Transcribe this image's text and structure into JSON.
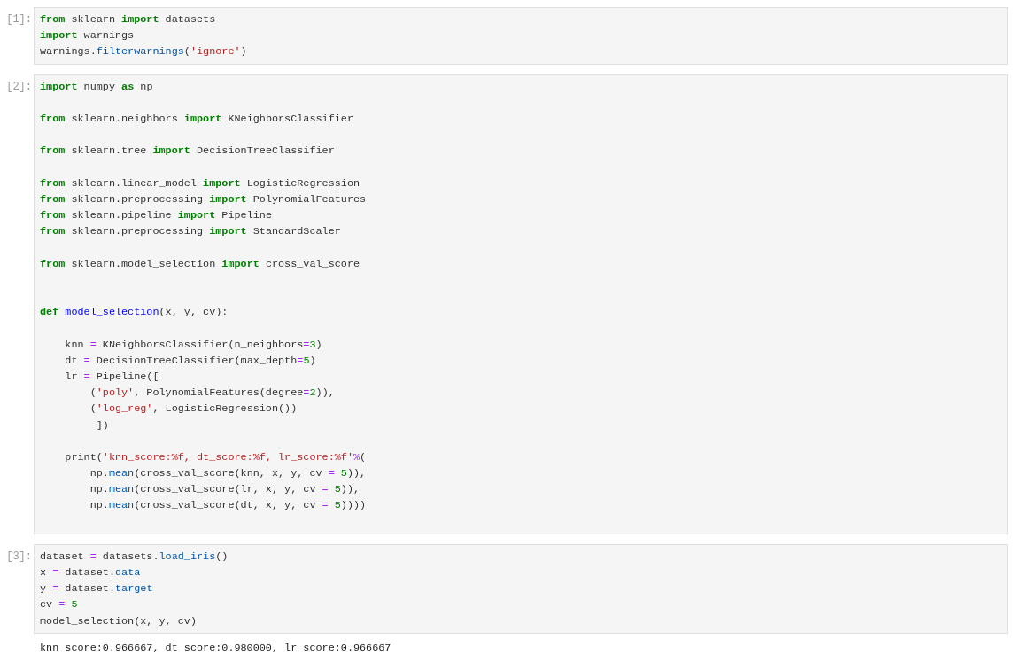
{
  "cells": [
    {
      "prompt": "[1]:",
      "lines": [
        {
          "kind": "code",
          "tokens": [
            {
              "kind": "kw",
              "text": "from"
            },
            {
              "kind": "plain",
              "text": " sklearn "
            },
            {
              "kind": "kw",
              "text": "import"
            },
            {
              "kind": "plain",
              "text": " datasets"
            }
          ]
        },
        {
          "kind": "code",
          "tokens": [
            {
              "kind": "kw",
              "text": "import"
            },
            {
              "kind": "plain",
              "text": " warnings"
            }
          ]
        },
        {
          "kind": "code",
          "tokens": [
            {
              "kind": "plain",
              "text": "warnings."
            },
            {
              "kind": "prop",
              "text": "filterwarnings"
            },
            {
              "kind": "plain",
              "text": "("
            },
            {
              "kind": "str",
              "text": "'ignore'"
            },
            {
              "kind": "plain",
              "text": ")"
            }
          ]
        }
      ]
    },
    {
      "prompt": "[2]:",
      "lines": [
        {
          "kind": "code",
          "tokens": [
            {
              "kind": "kw",
              "text": "import"
            },
            {
              "kind": "plain",
              "text": " numpy "
            },
            {
              "kind": "kw",
              "text": "as"
            },
            {
              "kind": "plain",
              "text": " np"
            }
          ]
        },
        {
          "kind": "blank"
        },
        {
          "kind": "code",
          "tokens": [
            {
              "kind": "kw",
              "text": "from"
            },
            {
              "kind": "plain",
              "text": " sklearn.neighbors "
            },
            {
              "kind": "kw",
              "text": "import"
            },
            {
              "kind": "plain",
              "text": " KNeighborsClassifier"
            }
          ]
        },
        {
          "kind": "blank"
        },
        {
          "kind": "code",
          "tokens": [
            {
              "kind": "kw",
              "text": "from"
            },
            {
              "kind": "plain",
              "text": " sklearn.tree "
            },
            {
              "kind": "kw",
              "text": "import"
            },
            {
              "kind": "plain",
              "text": " DecisionTreeClassifier"
            }
          ]
        },
        {
          "kind": "blank"
        },
        {
          "kind": "code",
          "tokens": [
            {
              "kind": "kw",
              "text": "from"
            },
            {
              "kind": "plain",
              "text": " sklearn.linear_model "
            },
            {
              "kind": "kw",
              "text": "import"
            },
            {
              "kind": "plain",
              "text": " LogisticRegression"
            }
          ]
        },
        {
          "kind": "code",
          "tokens": [
            {
              "kind": "kw",
              "text": "from"
            },
            {
              "kind": "plain",
              "text": " sklearn.preprocessing "
            },
            {
              "kind": "kw",
              "text": "import"
            },
            {
              "kind": "plain",
              "text": " PolynomialFeatures"
            }
          ]
        },
        {
          "kind": "code",
          "tokens": [
            {
              "kind": "kw",
              "text": "from"
            },
            {
              "kind": "plain",
              "text": " sklearn.pipeline "
            },
            {
              "kind": "kw",
              "text": "import"
            },
            {
              "kind": "plain",
              "text": " Pipeline"
            }
          ]
        },
        {
          "kind": "code",
          "tokens": [
            {
              "kind": "kw",
              "text": "from"
            },
            {
              "kind": "plain",
              "text": " sklearn.preprocessing "
            },
            {
              "kind": "kw",
              "text": "import"
            },
            {
              "kind": "plain",
              "text": " StandardScaler"
            }
          ]
        },
        {
          "kind": "blank"
        },
        {
          "kind": "code",
          "tokens": [
            {
              "kind": "kw",
              "text": "from"
            },
            {
              "kind": "plain",
              "text": " sklearn.model_selection "
            },
            {
              "kind": "kw",
              "text": "import"
            },
            {
              "kind": "plain",
              "text": " cross_val_score"
            }
          ]
        },
        {
          "kind": "blank"
        },
        {
          "kind": "blank"
        },
        {
          "kind": "code",
          "tokens": [
            {
              "kind": "kw",
              "text": "def"
            },
            {
              "kind": "def",
              "text": " model_selection"
            },
            {
              "kind": "plain",
              "text": "(x, y, cv):"
            }
          ]
        },
        {
          "kind": "blank"
        },
        {
          "kind": "code",
          "tokens": [
            {
              "kind": "plain",
              "text": "    knn "
            },
            {
              "kind": "op",
              "text": "="
            },
            {
              "kind": "plain",
              "text": " KNeighborsClassifier(n_neighbors"
            },
            {
              "kind": "op",
              "text": "="
            },
            {
              "kind": "num",
              "text": "3"
            },
            {
              "kind": "plain",
              "text": ")"
            }
          ]
        },
        {
          "kind": "code",
          "tokens": [
            {
              "kind": "plain",
              "text": "    dt "
            },
            {
              "kind": "op",
              "text": "="
            },
            {
              "kind": "plain",
              "text": " DecisionTreeClassifier(max_depth"
            },
            {
              "kind": "op",
              "text": "="
            },
            {
              "kind": "num",
              "text": "5"
            },
            {
              "kind": "plain",
              "text": ")"
            }
          ]
        },
        {
          "kind": "code",
          "tokens": [
            {
              "kind": "plain",
              "text": "    lr "
            },
            {
              "kind": "op",
              "text": "="
            },
            {
              "kind": "plain",
              "text": " Pipeline(["
            }
          ]
        },
        {
          "kind": "code",
          "tokens": [
            {
              "kind": "plain",
              "text": "        ("
            },
            {
              "kind": "str",
              "text": "'poly'"
            },
            {
              "kind": "plain",
              "text": ", PolynomialFeatures(degree"
            },
            {
              "kind": "op",
              "text": "="
            },
            {
              "kind": "num",
              "text": "2"
            },
            {
              "kind": "plain",
              "text": ")),"
            }
          ]
        },
        {
          "kind": "code",
          "tokens": [
            {
              "kind": "plain",
              "text": "        ("
            },
            {
              "kind": "str",
              "text": "'log_reg'"
            },
            {
              "kind": "plain",
              "text": ", LogisticRegression())"
            }
          ]
        },
        {
          "kind": "code",
          "tokens": [
            {
              "kind": "plain",
              "text": "         ])"
            }
          ]
        },
        {
          "kind": "blank"
        },
        {
          "kind": "code",
          "tokens": [
            {
              "kind": "plain",
              "text": "    print("
            },
            {
              "kind": "str",
              "text": "'knn_score:%f, dt_score:%f, lr_score:%f'"
            },
            {
              "kind": "op",
              "text": "%"
            },
            {
              "kind": "plain",
              "text": "("
            }
          ]
        },
        {
          "kind": "code",
          "tokens": [
            {
              "kind": "plain",
              "text": "        np."
            },
            {
              "kind": "prop",
              "text": "mean"
            },
            {
              "kind": "plain",
              "text": "(cross_val_score(knn, x, y, cv "
            },
            {
              "kind": "op",
              "text": "="
            },
            {
              "kind": "num",
              "text": " 5"
            },
            {
              "kind": "plain",
              "text": ")),"
            }
          ]
        },
        {
          "kind": "code",
          "tokens": [
            {
              "kind": "plain",
              "text": "        np."
            },
            {
              "kind": "prop",
              "text": "mean"
            },
            {
              "kind": "plain",
              "text": "(cross_val_score(lr, x, y, cv "
            },
            {
              "kind": "op",
              "text": "="
            },
            {
              "kind": "num",
              "text": " 5"
            },
            {
              "kind": "plain",
              "text": ")),"
            }
          ]
        },
        {
          "kind": "code",
          "tokens": [
            {
              "kind": "plain",
              "text": "        np."
            },
            {
              "kind": "prop",
              "text": "mean"
            },
            {
              "kind": "plain",
              "text": "(cross_val_score(dt, x, y, cv "
            },
            {
              "kind": "op",
              "text": "="
            },
            {
              "kind": "num",
              "text": " 5"
            },
            {
              "kind": "plain",
              "text": "))))"
            }
          ]
        },
        {
          "kind": "blank"
        }
      ]
    },
    {
      "prompt": "[3]:",
      "lines": [
        {
          "kind": "code",
          "tokens": [
            {
              "kind": "plain",
              "text": "dataset "
            },
            {
              "kind": "op",
              "text": "="
            },
            {
              "kind": "plain",
              "text": " datasets."
            },
            {
              "kind": "prop",
              "text": "load_iris"
            },
            {
              "kind": "plain",
              "text": "()"
            }
          ]
        },
        {
          "kind": "code",
          "tokens": [
            {
              "kind": "plain",
              "text": "x "
            },
            {
              "kind": "op",
              "text": "="
            },
            {
              "kind": "plain",
              "text": " dataset."
            },
            {
              "kind": "prop",
              "text": "data"
            }
          ]
        },
        {
          "kind": "code",
          "tokens": [
            {
              "kind": "plain",
              "text": "y "
            },
            {
              "kind": "op",
              "text": "="
            },
            {
              "kind": "plain",
              "text": " dataset."
            },
            {
              "kind": "prop",
              "text": "target"
            }
          ]
        },
        {
          "kind": "code",
          "tokens": [
            {
              "kind": "plain",
              "text": "cv "
            },
            {
              "kind": "op",
              "text": "="
            },
            {
              "kind": "num",
              "text": " 5"
            }
          ]
        },
        {
          "kind": "code",
          "tokens": [
            {
              "kind": "plain",
              "text": "model_selection(x, y, cv)"
            }
          ]
        }
      ],
      "output": "knn_score:0.966667, dt_score:0.980000, lr_score:0.966667"
    }
  ]
}
